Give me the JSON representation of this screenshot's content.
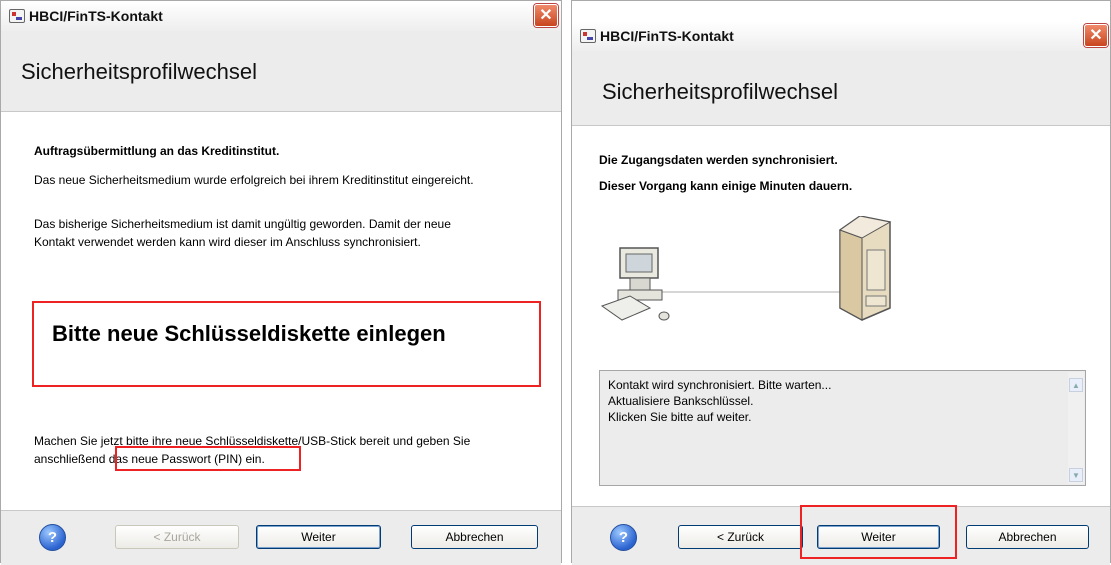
{
  "left": {
    "title": "HBCI/FinTS-Kontakt",
    "header": "Sicherheitsprofilwechsel",
    "heading": "Auftragsübermittlung an das Kreditinstitut.",
    "line1": "Das neue Sicherheitsmedium wurde erfolgreich bei ihrem Kreditinstitut eingereicht.",
    "line2a": "Das bisherige Sicherheitsmedium ist damit ungültig geworden. Damit der neue",
    "line2b": "Kontakt verwendet werden kann wird dieser im Anschluss synchronisiert.",
    "prompt": "Bitte neue Schlüsseldiskette einlegen",
    "line3a": "Machen Sie jetzt bitte ihre neue Schlüsseldiskette/USB-Stick bereit und geben Sie",
    "line3b_pre": "anschließend ",
    "line3b_hl": "das neue Passwort (PIN) ein.",
    "buttons": {
      "back": "< Zurück",
      "next": "Weiter",
      "cancel": "Abbrechen"
    }
  },
  "right": {
    "title": "HBCI/FinTS-Kontakt",
    "header": "Sicherheitsprofilwechsel",
    "line1": "Die Zugangsdaten werden synchronisiert.",
    "line2": "Dieser Vorgang kann einige Minuten dauern.",
    "log": [
      "Kontakt wird synchronisiert. Bitte warten...",
      "Aktualisiere Bankschlüssel.",
      "Klicken Sie bitte auf weiter."
    ],
    "buttons": {
      "back": "< Zurück",
      "next": "Weiter",
      "cancel": "Abbrechen"
    }
  },
  "colors": {
    "highlight": "#e22222",
    "header_bg": "#ececec"
  },
  "icons": {
    "help": "help-icon",
    "close": "close-icon",
    "computer": "computer-icon",
    "server": "server-icon"
  }
}
